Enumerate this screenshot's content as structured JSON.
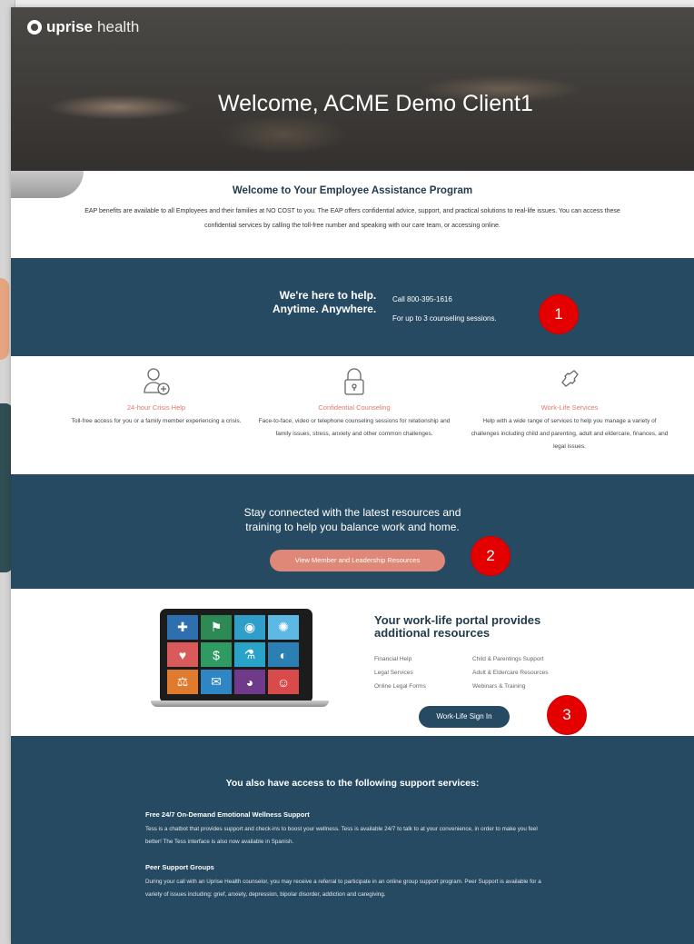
{
  "brand": {
    "bold": "uprise",
    "light": "health"
  },
  "hero": {
    "title": "Welcome, ACME Demo Client1"
  },
  "intro": {
    "heading": "Welcome to Your Employee Assistance Program",
    "body": "EAP benefits are available to all Employees and their families at NO COST to you. The EAP offers confidential advice, support, and practical solutions to real-life issues. You can access these confidential services by calling the toll-free number and speaking with our care team, or accessing online."
  },
  "help": {
    "tagline_line1": "We're here to help.",
    "tagline_line2": "Anytime. Anywhere.",
    "call": "Call 800-395-1616",
    "sessions": "For up to 3 counseling sessions."
  },
  "badges": [
    "1",
    "2",
    "3"
  ],
  "services": [
    {
      "icon": "doctor-plus-icon",
      "title": "24-hour Crisis Help",
      "desc": "Toll-free access for you or a family member experiencing a crisis."
    },
    {
      "icon": "lock-icon",
      "title": "Confidential Counseling",
      "desc": "Face-to-face, video or telephone counseling sessions for relationship and family issues, stress, anxiety and other common challenges."
    },
    {
      "icon": "phone-icon",
      "title": "Work-Life Services",
      "desc": "Help with a wide range of services to help you manage a variety of challenges including child and parenting, adult and eldercare, finances, and legal issues."
    }
  ],
  "resources": {
    "message_line1": "Stay connected with the latest resources and",
    "message_line2": "training to help you balance work and home.",
    "button": "View Member and Leadership Resources"
  },
  "portal": {
    "heading": "Your work-life portal provides additional resources",
    "links": [
      "Financial Help",
      "Child & Parentings Support",
      "Legal Services",
      "Adult & Eldercare Resources",
      "Online Legal Forms",
      "Webinars & Training"
    ],
    "signin": "Work-Life Sign In",
    "tiles": [
      "#2e6fb0",
      "#2e8a55",
      "#2f9ec8",
      "#5db8e4",
      "#d95a5a",
      "#2f9a62",
      "#2aa3c9",
      "#2b7fb2",
      "#e07a2c",
      "#2f86c4",
      "#6f3a8a",
      "#d94a4a"
    ]
  },
  "support": {
    "heading": "You also have access to the following support services:",
    "items": [
      {
        "title": "Free 24/7 On-Demand Emotional Wellness Support",
        "desc": "Tess is a chatbot that provides support and check-ins to boost your wellness. Tess is available 24/7 to talk to at your convenience, in order to make you feel better! The Tess interface is also now available in Spanish."
      },
      {
        "title": "Peer Support Groups",
        "desc": "During your call with an Uprise Health counselor, you may receive a referral to participate in an online group support program. Peer Support is available for a variety of issues including: grief, anxiety, depression, bipolar disorder, addiction and caregiving."
      }
    ]
  },
  "colors": {
    "navy": "#264a62",
    "coral": "#df8877",
    "badge_red": "#e50000"
  }
}
